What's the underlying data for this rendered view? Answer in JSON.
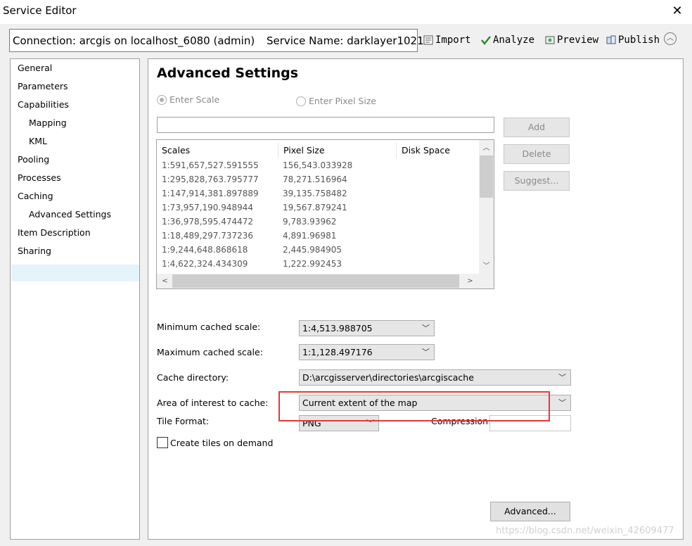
{
  "window": {
    "title": "Service Editor",
    "close_glyph": "✕"
  },
  "connection_bar": {
    "connection": "Connection: arcgis on localhost_6080 (admin)",
    "service_name": "Service Name: darklayer1021"
  },
  "toolbar": [
    {
      "label": "Import",
      "icon": "import-icon"
    },
    {
      "label": "Analyze",
      "icon": "check-icon"
    },
    {
      "label": "Preview",
      "icon": "preview-icon"
    },
    {
      "label": "Publish",
      "icon": "publish-icon"
    }
  ],
  "nav": {
    "items": [
      {
        "label": "General"
      },
      {
        "label": "Parameters"
      },
      {
        "label": "Capabilities"
      },
      {
        "label": "Mapping"
      },
      {
        "label": "KML"
      },
      {
        "label": "Pooling"
      },
      {
        "label": "Processes"
      },
      {
        "label": "Caching"
      },
      {
        "label": "Advanced Settings",
        "selected": true
      },
      {
        "label": "Item Description"
      },
      {
        "label": "Sharing"
      }
    ]
  },
  "main": {
    "heading": "Advanced Settings",
    "radio_scale": "Enter Scale",
    "radio_pixel": "Enter Pixel Size",
    "scale_input_value": "",
    "buttons": {
      "add": "Add",
      "delete": "Delete",
      "suggest": "Suggest..."
    },
    "table": {
      "headers": [
        "Scales",
        "Pixel Size",
        "Disk Space"
      ],
      "rows": [
        [
          "1:591,657,527.591555",
          "156,543.033928",
          ""
        ],
        [
          "1:295,828,763.795777",
          "78,271.516964",
          ""
        ],
        [
          "1:147,914,381.897889",
          "39,135.758482",
          ""
        ],
        [
          "1:73,957,190.948944",
          "19,567.879241",
          ""
        ],
        [
          "1:36,978,595.474472",
          "9,783.93962",
          ""
        ],
        [
          "1:18,489,297.737236",
          "4,891.96981",
          ""
        ],
        [
          "1:9,244,648.868618",
          "2,445.984905",
          ""
        ],
        [
          "1:4,622,324.434309",
          "1,222.992453",
          ""
        ]
      ]
    },
    "min_scale_label": "Minimum cached scale:",
    "min_scale_value": "1:4,513.988705",
    "max_scale_label": "Maximum cached scale:",
    "max_scale_value": "1:1,128.497176",
    "cache_dir_label": "Cache directory:",
    "cache_dir_value": "D:\\arcgisserver\\directories\\arcgiscache",
    "aoi_label": "Area of interest to cache:",
    "aoi_value": "Current extent of the map",
    "tile_format_label": "Tile Format:",
    "tile_format_value": "PNG",
    "compression_label": "Compression:",
    "compression_value": "",
    "create_on_demand_label": "Create tiles on demand",
    "advanced_button": "Advanced..."
  },
  "watermark": "https://blog.csdn.net/weixin_42609477",
  "colors": {
    "highlight_box": "#e53935",
    "selection": "#e5f3fb",
    "analyze_check": "#2e8b2e"
  }
}
